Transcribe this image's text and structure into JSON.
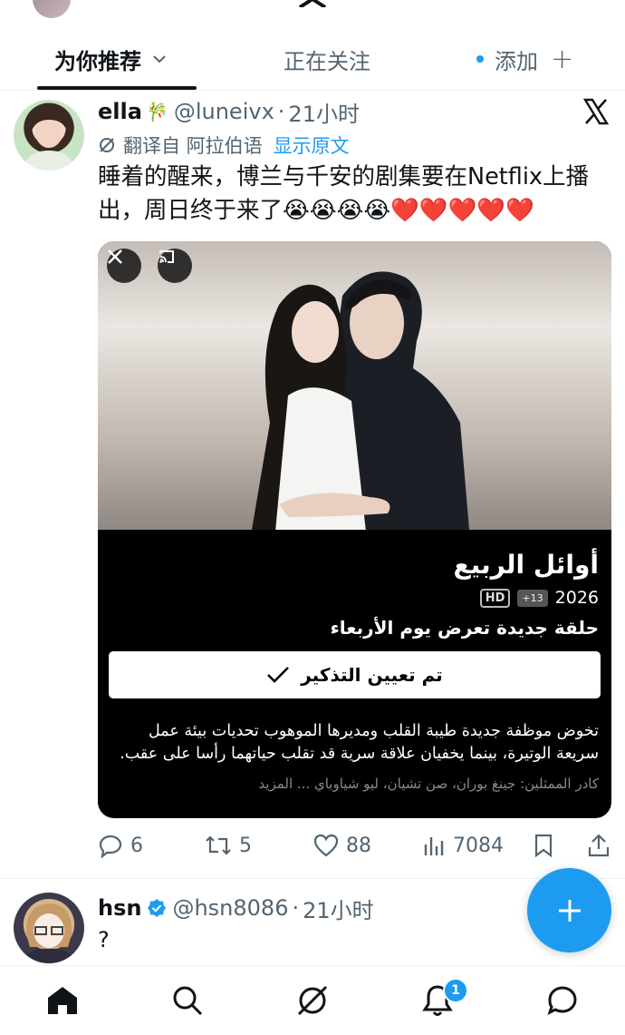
{
  "tabs": {
    "for_you": "为你推荐",
    "following": "正在关注",
    "add": "添加"
  },
  "tweet1": {
    "name": "ella",
    "name_emoji": "🎋",
    "handle": "@luneivx",
    "separator": "·",
    "time": "21小时",
    "translate_label": "翻译自 阿拉伯语",
    "show_original": "显示原文",
    "text": "睡着的醒来，博兰与千安的剧集要在Netflix上播出，周日终于来了😭😭😭😭❤️❤️❤️❤️❤️",
    "media": {
      "show_title": "أوائل الربيع",
      "year": "2026",
      "age_rating": "+13",
      "quality": "HD",
      "new_episode": "حلقة جديدة تعرض يوم الأربعاء",
      "remind_button": "تم تعيين التذكير",
      "description": "تخوض موظفة جديدة طيبة القلب ومديرها الموهوب تحديات بيئة عمل سريعة الوتيرة، بينما يخفيان علاقة سرية قد تقلب حياتهما رأسا على عقب.",
      "cast": "كادر الممثلين: جينغ بوران، صن تشيان، ليو شياوباي ... المزيد"
    },
    "stats": {
      "replies": "6",
      "retweets": "5",
      "likes": "88",
      "views": "7084"
    }
  },
  "tweet2": {
    "name": "hsn",
    "handle": "@hsn8086",
    "separator": "·",
    "time": "21小时",
    "text": "?"
  },
  "nav": {
    "notification_count": "1"
  },
  "colors": {
    "accent": "#1d9bf0",
    "text_primary": "#0f1419",
    "text_secondary": "#536471",
    "like_red": "#f91880"
  },
  "icons": [
    "chevron-down-icon",
    "plus-icon",
    "x-logo-icon",
    "translate-icon",
    "close-icon",
    "cast-icon",
    "checkmark-icon",
    "reply-icon",
    "retweet-icon",
    "like-icon",
    "views-icon",
    "bookmark-icon",
    "share-icon",
    "verified-icon",
    "compose-icon",
    "home-icon",
    "search-icon",
    "grok-icon",
    "notification-icon",
    "messages-icon"
  ]
}
